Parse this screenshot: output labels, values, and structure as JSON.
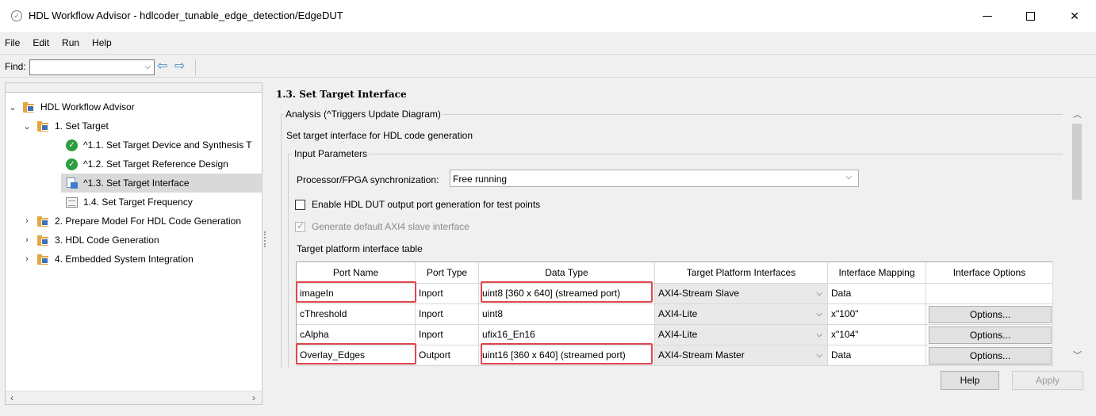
{
  "window": {
    "title": "HDL Workflow Advisor - hdlcoder_tunable_edge_detection/EdgeDUT",
    "min_icon": "minimize-icon",
    "max_icon": "maximize-icon",
    "close_label": "✕"
  },
  "menu": [
    "File",
    "Edit",
    "Run",
    "Help"
  ],
  "find": {
    "label": "Find:",
    "value": "",
    "back_icon": "⇦",
    "fwd_icon": "⇨"
  },
  "tree": [
    {
      "label": "HDL Workflow Advisor",
      "level": 0,
      "expander": "expanded",
      "icon": "folder-icon"
    },
    {
      "label": "1. Set Target",
      "level": 1,
      "expander": "expanded",
      "icon": "folder-icon"
    },
    {
      "label": "^1.1. Set Target Device and Synthesis T",
      "level": 2,
      "icon": "check-icon"
    },
    {
      "label": "^1.2. Set Target Reference Design",
      "level": 2,
      "icon": "check-icon"
    },
    {
      "label": "^1.3. Set Target Interface",
      "level": 2,
      "icon": "task-icon",
      "selected": true
    },
    {
      "label": "1.4. Set Target Frequency",
      "level": 2,
      "icon": "list-icon"
    },
    {
      "label": "2. Prepare Model For HDL Code Generation",
      "level": 1,
      "expander": "collapsed",
      "icon": "folder-icon"
    },
    {
      "label": "3. HDL Code Generation",
      "level": 1,
      "expander": "collapsed",
      "icon": "folder-icon"
    },
    {
      "label": "4. Embedded System Integration",
      "level": 1,
      "expander": "collapsed",
      "icon": "folder-icon"
    }
  ],
  "panel": {
    "title": "1.3. Set Target Interface",
    "analysis_legend": "Analysis (^Triggers Update Diagram)",
    "description": "Set target interface for HDL code generation",
    "input_legend": "Input Parameters",
    "sync_label": "Processor/FPGA synchronization:",
    "sync_value": "Free running",
    "cb_testpoints": "Enable HDL DUT output port generation for test points",
    "cb_axi4": "Generate default AXI4 slave interface",
    "table_label": "Target platform interface table"
  },
  "table": {
    "headers": [
      "Port Name",
      "Port Type",
      "Data Type",
      "Target Platform Interfaces",
      "Interface Mapping",
      "Interface Options"
    ],
    "rows": [
      {
        "port": "imageIn",
        "type": "Inport",
        "dtype": "uint8 [360 x 640] (streamed port)",
        "iface": "AXI4-Stream Slave",
        "mapping": "Data",
        "options": ""
      },
      {
        "port": "cThreshold",
        "type": "Inport",
        "dtype": "uint8",
        "iface": "AXI4-Lite",
        "mapping": "x\"100\"",
        "options": "Options..."
      },
      {
        "port": "cAlpha",
        "type": "Inport",
        "dtype": "ufix16_En16",
        "iface": "AXI4-Lite",
        "mapping": "x\"104\"",
        "options": "Options..."
      },
      {
        "port": "Overlay_Edges",
        "type": "Outport",
        "dtype": "uint16 [360 x 640] (streamed port)",
        "iface": "AXI4-Stream Master",
        "mapping": "Data",
        "options": "Options..."
      }
    ]
  },
  "buttons": {
    "help": "Help",
    "apply": "Apply"
  },
  "colors": {
    "highlight": "#e0474c",
    "check_green": "#2e9e3f",
    "folder": "#e3a640",
    "selected_row": "#d9d9d9"
  }
}
